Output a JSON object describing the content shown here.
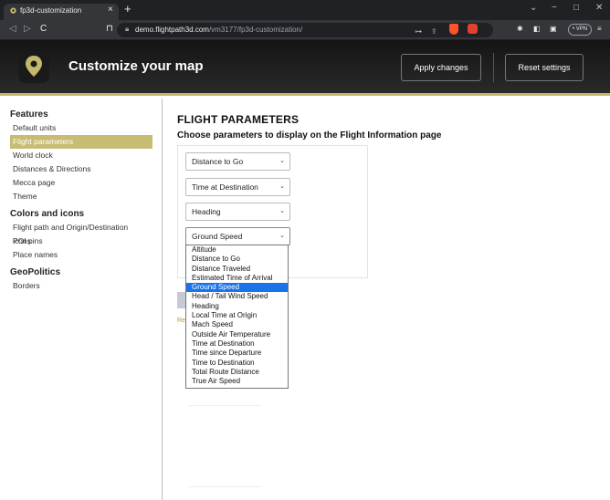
{
  "browser": {
    "tab_title": "fp3d-customization",
    "tab_close": "×",
    "new_tab": "+",
    "url_domain": "demo.flightpath3d.com",
    "url_path": "/vm3177/fp3d-customization/",
    "vpn_label": "• VPN"
  },
  "header": {
    "title": "Customize your map",
    "apply_label": "Apply changes",
    "reset_label": "Reset settings",
    "accent_color": "#c5b86d"
  },
  "sidebar": {
    "sections": [
      {
        "title": "Features",
        "items": [
          "Default units",
          "Flight parameters",
          "World clock",
          "Distances & Directions",
          "Mecca page",
          "Theme"
        ]
      },
      {
        "title": "Colors and icons",
        "items": [
          "Flight path and Origin/Destination icons",
          "POI pins",
          "Place names"
        ]
      },
      {
        "title": "GeoPolitics",
        "items": [
          "Borders"
        ]
      }
    ],
    "active_item": "Flight parameters"
  },
  "main": {
    "title": "FLIGHT PARAMETERS",
    "subtitle": "Choose parameters to display on the Flight Information page",
    "selects": [
      "Distance to Go",
      "Time at Destination",
      "Heading",
      "Ground Speed"
    ],
    "options": [
      "Altitude",
      "Distance to Go",
      "Distance Traveled",
      "Estimated Time of Arrival",
      "Ground Speed",
      "Head / Tail Wind Speed",
      "Heading",
      "Local Time at Origin",
      "Mach Speed",
      "Outside Air Temperature",
      "Time at Destination",
      "Time since Departure",
      "Time to Destination",
      "Total Route Distance",
      "True Air Speed"
    ],
    "highlighted_option": "Ground Speed",
    "partial_link": "Re"
  }
}
